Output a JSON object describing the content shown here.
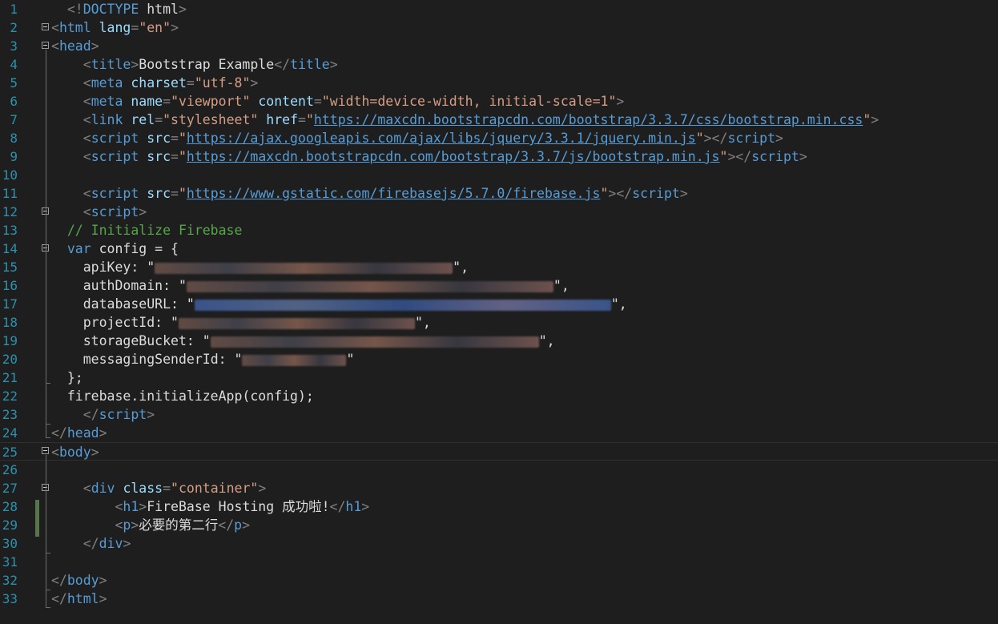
{
  "editor": {
    "lines": [
      {
        "n": "1",
        "parts": [
          [
            "punc",
            "<!"
          ],
          [
            "tag",
            "DOCTYPE"
          ],
          [
            "text",
            " html"
          ],
          [
            "punc",
            ">"
          ]
        ],
        "indent": "  "
      },
      {
        "n": "2",
        "parts": [
          [
            "punc",
            "<"
          ],
          [
            "tag",
            "html"
          ],
          [
            "text",
            " "
          ],
          [
            "attr",
            "lang"
          ],
          [
            "punc",
            "="
          ],
          [
            "text",
            "\"en\""
          ],
          [
            "punc",
            ">"
          ]
        ],
        "indent": ""
      },
      {
        "n": "3",
        "parts": [
          [
            "punc",
            "<"
          ],
          [
            "tag",
            "head"
          ],
          [
            "punc",
            ">"
          ]
        ],
        "indent": ""
      },
      {
        "n": "4",
        "parts": [
          [
            "punc",
            "<"
          ],
          [
            "tag",
            "title"
          ],
          [
            "punc",
            ">"
          ],
          [
            "text",
            "Bootstrap Example"
          ],
          [
            "punc",
            "</"
          ],
          [
            "tag",
            "title"
          ],
          [
            "punc",
            ">"
          ]
        ],
        "indent": "    "
      },
      {
        "n": "5",
        "parts": [
          [
            "punc",
            "<"
          ],
          [
            "tag",
            "meta"
          ],
          [
            "text",
            " "
          ],
          [
            "attr",
            "charset"
          ],
          [
            "punc",
            "="
          ],
          [
            "text",
            "\"utf-8\""
          ],
          [
            "punc",
            ">"
          ]
        ],
        "indent": "    "
      },
      {
        "n": "6",
        "parts": [
          [
            "punc",
            "<"
          ],
          [
            "tag",
            "meta"
          ],
          [
            "text",
            " "
          ],
          [
            "attr",
            "name"
          ],
          [
            "punc",
            "="
          ],
          [
            "text",
            "\"viewport\""
          ],
          [
            "text",
            " "
          ],
          [
            "attr",
            "content"
          ],
          [
            "punc",
            "="
          ],
          [
            "text",
            "\"width=device-width, initial-scale=1\""
          ],
          [
            "punc",
            ">"
          ]
        ],
        "indent": "    "
      },
      {
        "n": "7",
        "parts": [
          [
            "punc",
            "<"
          ],
          [
            "tag",
            "link"
          ],
          [
            "text",
            " "
          ],
          [
            "attr",
            "rel"
          ],
          [
            "punc",
            "="
          ],
          [
            "text",
            "\"stylesheet\""
          ],
          [
            "text",
            " "
          ],
          [
            "attr",
            "href"
          ],
          [
            "punc",
            "="
          ],
          [
            "text",
            "\""
          ],
          [
            "url",
            "https://maxcdn.bootstrapcdn.com/bootstrap/3.3.7/css/bootstrap.min.css"
          ],
          [
            "text",
            "\""
          ],
          [
            "punc",
            ">"
          ]
        ],
        "indent": "    "
      },
      {
        "n": "8",
        "parts": [
          [
            "punc",
            "<"
          ],
          [
            "tag",
            "script"
          ],
          [
            "text",
            " "
          ],
          [
            "attr",
            "src"
          ],
          [
            "punc",
            "="
          ],
          [
            "text",
            "\""
          ],
          [
            "url",
            "https://ajax.googleapis.com/ajax/libs/jquery/3.3.1/jquery.min.js"
          ],
          [
            "text",
            "\""
          ],
          [
            "punc",
            "></"
          ],
          [
            "tag",
            "script"
          ],
          [
            "punc",
            ">"
          ]
        ],
        "indent": "    "
      },
      {
        "n": "9",
        "parts": [
          [
            "punc",
            "<"
          ],
          [
            "tag",
            "script"
          ],
          [
            "text",
            " "
          ],
          [
            "attr",
            "src"
          ],
          [
            "punc",
            "="
          ],
          [
            "text",
            "\""
          ],
          [
            "url",
            "https://maxcdn.bootstrapcdn.com/bootstrap/3.3.7/js/bootstrap.min.js"
          ],
          [
            "text",
            "\""
          ],
          [
            "punc",
            "></"
          ],
          [
            "tag",
            "script"
          ],
          [
            "punc",
            ">"
          ]
        ],
        "indent": "    "
      },
      {
        "n": "10",
        "parts": [],
        "indent": ""
      },
      {
        "n": "11",
        "parts": [
          [
            "punc",
            "<"
          ],
          [
            "tag",
            "script"
          ],
          [
            "text",
            " "
          ],
          [
            "attr",
            "src"
          ],
          [
            "punc",
            "="
          ],
          [
            "text",
            "\""
          ],
          [
            "url",
            "https://www.gstatic.com/firebasejs/5.7.0/firebase.js"
          ],
          [
            "text",
            "\""
          ],
          [
            "punc",
            "></"
          ],
          [
            "tag",
            "script"
          ],
          [
            "punc",
            ">"
          ]
        ],
        "indent": "    "
      },
      {
        "n": "12",
        "parts": [
          [
            "punc",
            "<"
          ],
          [
            "tag",
            "script"
          ],
          [
            "punc",
            ">"
          ]
        ],
        "indent": "    "
      },
      {
        "n": "13",
        "parts": [
          [
            "com",
            "// Initialize Firebase"
          ]
        ],
        "indent": "  "
      },
      {
        "n": "14",
        "parts": [
          [
            "kw",
            "var"
          ],
          [
            "id",
            " config = {"
          ]
        ],
        "indent": "  "
      },
      {
        "n": "15",
        "parts": [
          [
            "id",
            "apiKey: \""
          ],
          [
            "blur",
            "372"
          ],
          [
            "id",
            "\","
          ]
        ],
        "indent": "    "
      },
      {
        "n": "16",
        "parts": [
          [
            "id",
            "authDomain: \""
          ],
          [
            "blur",
            "458"
          ],
          [
            "id",
            "\","
          ]
        ],
        "indent": "    "
      },
      {
        "n": "17",
        "parts": [
          [
            "id",
            "databaseURL: \""
          ],
          [
            "blurblue",
            "520"
          ],
          [
            "id",
            "\","
          ]
        ],
        "indent": "    "
      },
      {
        "n": "18",
        "parts": [
          [
            "id",
            "projectId: \""
          ],
          [
            "blur",
            "295"
          ],
          [
            "id",
            "\","
          ]
        ],
        "indent": "    "
      },
      {
        "n": "19",
        "parts": [
          [
            "id",
            "storageBucket: \""
          ],
          [
            "blur",
            "410"
          ],
          [
            "id",
            "\","
          ]
        ],
        "indent": "    "
      },
      {
        "n": "20",
        "parts": [
          [
            "id",
            "messagingSenderId: \""
          ],
          [
            "blur",
            "130"
          ],
          [
            "id",
            "\""
          ]
        ],
        "indent": "    "
      },
      {
        "n": "21",
        "parts": [
          [
            "id",
            "};"
          ]
        ],
        "indent": "  "
      },
      {
        "n": "22",
        "parts": [
          [
            "id",
            "firebase.initializeApp(config);"
          ]
        ],
        "indent": "  "
      },
      {
        "n": "23",
        "parts": [
          [
            "punc",
            "</"
          ],
          [
            "tag",
            "script"
          ],
          [
            "punc",
            ">"
          ]
        ],
        "indent": "    "
      },
      {
        "n": "24",
        "parts": [
          [
            "punc",
            "</"
          ],
          [
            "tag",
            "head"
          ],
          [
            "punc",
            ">"
          ]
        ],
        "indent": ""
      },
      {
        "n": "25",
        "parts": [
          [
            "punc",
            "<"
          ],
          [
            "tag",
            "body"
          ],
          [
            "punc",
            ">"
          ]
        ],
        "indent": ""
      },
      {
        "n": "26",
        "parts": [],
        "indent": ""
      },
      {
        "n": "27",
        "parts": [
          [
            "punc",
            "<"
          ],
          [
            "tag",
            "div"
          ],
          [
            "text",
            " "
          ],
          [
            "attr",
            "class"
          ],
          [
            "punc",
            "="
          ],
          [
            "text",
            "\"container\""
          ],
          [
            "punc",
            ">"
          ]
        ],
        "indent": "    "
      },
      {
        "n": "28",
        "parts": [
          [
            "punc",
            "<"
          ],
          [
            "tag",
            "h1"
          ],
          [
            "punc",
            ">"
          ],
          [
            "text",
            "FireBase Hosting 成功啦!"
          ],
          [
            "punc",
            "</"
          ],
          [
            "tag",
            "h1"
          ],
          [
            "punc",
            ">"
          ]
        ],
        "indent": "        "
      },
      {
        "n": "29",
        "parts": [
          [
            "punc",
            "<"
          ],
          [
            "tag",
            "p"
          ],
          [
            "punc",
            ">"
          ],
          [
            "text",
            "必要的第二行"
          ],
          [
            "punc",
            "</"
          ],
          [
            "tag",
            "p"
          ],
          [
            "punc",
            ">"
          ]
        ],
        "indent": "        "
      },
      {
        "n": "30",
        "parts": [
          [
            "punc",
            "</"
          ],
          [
            "tag",
            "div"
          ],
          [
            "punc",
            ">"
          ]
        ],
        "indent": "    "
      },
      {
        "n": "31",
        "parts": [],
        "indent": ""
      },
      {
        "n": "32",
        "parts": [
          [
            "punc",
            "</"
          ],
          [
            "tag",
            "body"
          ],
          [
            "punc",
            ">"
          ]
        ],
        "indent": ""
      },
      {
        "n": "33",
        "parts": [
          [
            "punc",
            "</"
          ],
          [
            "tag",
            "html"
          ],
          [
            "punc",
            ">"
          ]
        ],
        "indent": ""
      }
    ]
  },
  "colors": {
    "background": "#1e1e1e",
    "line_numbers": "#2b91af",
    "tag": "#569cd6",
    "attribute": "#9cdcfe",
    "string": "#d69d85",
    "comment": "#57a64a",
    "change_bar": "#57744b"
  }
}
